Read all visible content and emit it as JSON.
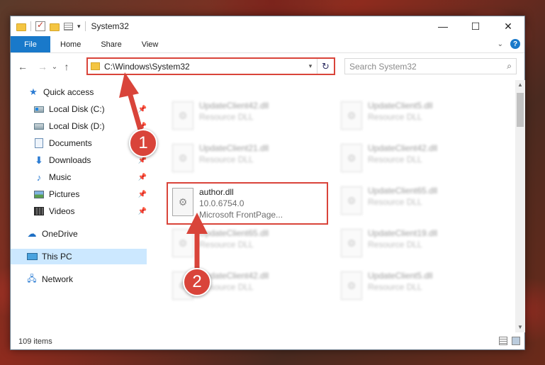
{
  "window": {
    "title": "System32",
    "controls": {
      "minimize": "—",
      "maximize": "☐",
      "close": "✕"
    }
  },
  "ribbon": {
    "tabs": [
      "File",
      "Home",
      "Share",
      "View"
    ]
  },
  "navigation": {
    "back": "←",
    "forward": "→",
    "recent": "⌄",
    "up": "↑",
    "address": "C:\\Windows\\System32",
    "search_placeholder": "Search System32"
  },
  "sidebar": {
    "items": [
      {
        "label": "Quick access",
        "icon": "star-icon",
        "pinned": false
      },
      {
        "label": "Local Disk (C:)",
        "icon": "disk-icon",
        "pinned": true
      },
      {
        "label": "Local Disk (D:)",
        "icon": "disk-icon",
        "pinned": true
      },
      {
        "label": "Documents",
        "icon": "documents-icon",
        "pinned": true
      },
      {
        "label": "Downloads",
        "icon": "download-icon",
        "pinned": true
      },
      {
        "label": "Music",
        "icon": "music-icon",
        "pinned": true
      },
      {
        "label": "Pictures",
        "icon": "pictures-icon",
        "pinned": true
      },
      {
        "label": "Videos",
        "icon": "videos-icon",
        "pinned": true
      },
      {
        "label": "OneDrive",
        "icon": "cloud-icon",
        "pinned": false
      },
      {
        "label": "This PC",
        "icon": "computer-icon",
        "pinned": false,
        "selected": true
      },
      {
        "label": "Network",
        "icon": "network-icon",
        "pinned": false
      }
    ],
    "pin_glyph": "📌"
  },
  "files": [
    {
      "name": "UpdateClient42.dll",
      "desc": "Resource DLL",
      "blurred": true
    },
    {
      "name": "UpdateClient5.dll",
      "desc": "Resource DLL",
      "blurred": true
    },
    {
      "name": "UpdateClient21.dll",
      "desc": "Resource DLL",
      "blurred": true
    },
    {
      "name": "UpdateClient42.dll",
      "desc": "Resource DLL",
      "blurred": true
    },
    {
      "name": "author.dll",
      "version": "10.0.6754.0",
      "desc": "Microsoft FrontPage...",
      "blurred": false,
      "highlighted": true
    },
    {
      "name": "UpdateClient65.dll",
      "desc": "Resource DLL",
      "blurred": true
    },
    {
      "name": "UpdateClient65.dll",
      "desc": "Resource DLL",
      "blurred": true
    },
    {
      "name": "UpdateClient19.dll",
      "desc": "Resource DLL",
      "blurred": true
    },
    {
      "name": "UpdateClient42.dll",
      "desc": "Resource DLL",
      "blurred": true
    },
    {
      "name": "UpdateClient5.dll",
      "desc": "Resource DLL",
      "blurred": true
    }
  ],
  "status": {
    "item_count": "109 items"
  },
  "callouts": [
    "1",
    "2"
  ],
  "colors": {
    "accent": "#1979ca",
    "annotation": "#d9443a",
    "selected_bg": "#cce8ff"
  }
}
